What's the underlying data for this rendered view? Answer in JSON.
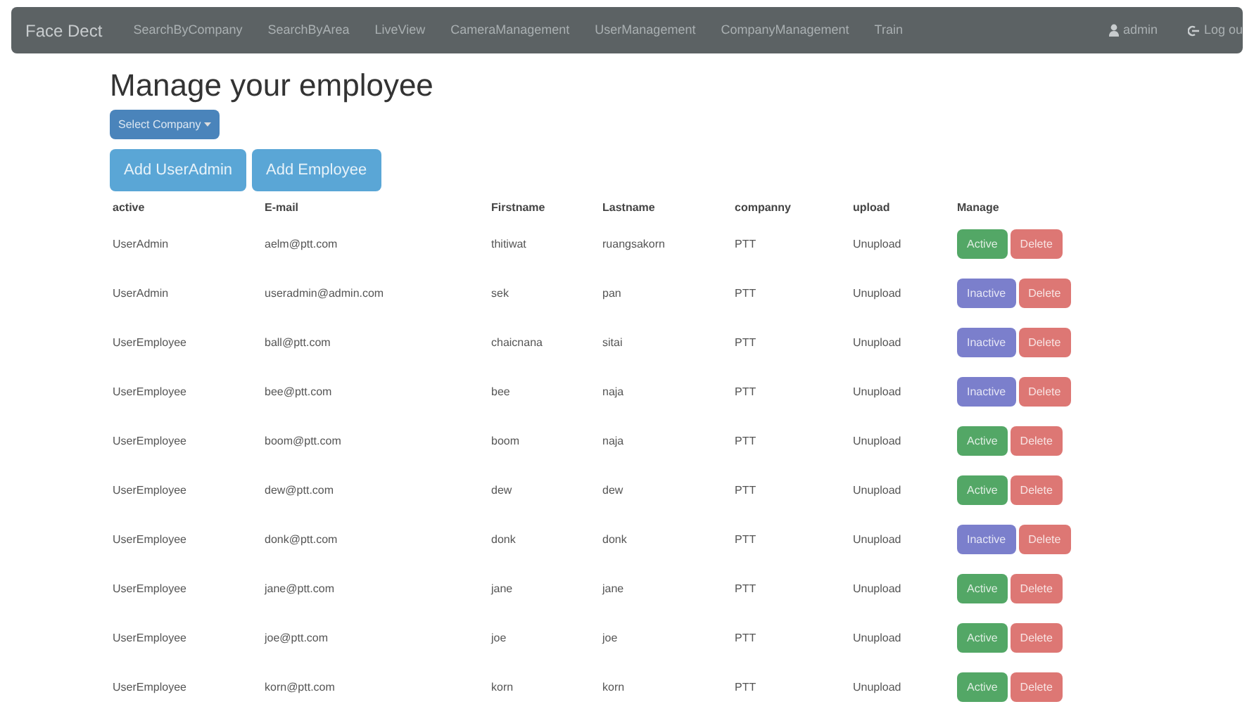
{
  "navbar": {
    "brand": "Face Dect",
    "links": [
      "SearchByCompany",
      "SearchByArea",
      "LiveView",
      "CameraManagement",
      "UserManagement",
      "CompanyManagement",
      "Train"
    ],
    "user": "admin",
    "logout": "Log ou"
  },
  "heading": "Manage your employee",
  "select_company": "Select Company",
  "buttons": [
    "Add UserAdmin",
    "Add Employee"
  ],
  "table": {
    "columns": [
      "active",
      "E-mail",
      "Firstname",
      "Lastname",
      "companny",
      "upload",
      "Manage"
    ],
    "rows": [
      {
        "role": "UserAdmin",
        "email": "aelm@ptt.com",
        "firstname": "thitiwat",
        "lastname": "ruangsakorn",
        "company": "PTT",
        "upload": "Unupload",
        "status": "Active",
        "active": true,
        "delete": "Delete"
      },
      {
        "role": "UserAdmin",
        "email": "useradmin@admin.com",
        "firstname": "sek",
        "lastname": "pan",
        "company": "PTT",
        "upload": "Unupload",
        "status": "Inactive",
        "active": false,
        "delete": "Delete"
      },
      {
        "role": "UserEmployee",
        "email": "ball@ptt.com",
        "firstname": "chaicnana",
        "lastname": "sitai",
        "company": "PTT",
        "upload": "Unupload",
        "status": "Inactive",
        "active": false,
        "delete": "Delete"
      },
      {
        "role": "UserEmployee",
        "email": "bee@ptt.com",
        "firstname": "bee",
        "lastname": "naja",
        "company": "PTT",
        "upload": "Unupload",
        "status": "Inactive",
        "active": false,
        "delete": "Delete"
      },
      {
        "role": "UserEmployee",
        "email": "boom@ptt.com",
        "firstname": "boom",
        "lastname": "naja",
        "company": "PTT",
        "upload": "Unupload",
        "status": "Active",
        "active": true,
        "delete": "Delete"
      },
      {
        "role": "UserEmployee",
        "email": "dew@ptt.com",
        "firstname": "dew",
        "lastname": "dew",
        "company": "PTT",
        "upload": "Unupload",
        "status": "Active",
        "active": true,
        "delete": "Delete"
      },
      {
        "role": "UserEmployee",
        "email": "donk@ptt.com",
        "firstname": "donk",
        "lastname": "donk",
        "company": "PTT",
        "upload": "Unupload",
        "status": "Inactive",
        "active": false,
        "delete": "Delete"
      },
      {
        "role": "UserEmployee",
        "email": "jane@ptt.com",
        "firstname": "jane",
        "lastname": "jane",
        "company": "PTT",
        "upload": "Unupload",
        "status": "Active",
        "active": true,
        "delete": "Delete"
      },
      {
        "role": "UserEmployee",
        "email": "joe@ptt.com",
        "firstname": "joe",
        "lastname": "joe",
        "company": "PTT",
        "upload": "Unupload",
        "status": "Active",
        "active": true,
        "delete": "Delete"
      },
      {
        "role": "UserEmployee",
        "email": "korn@ptt.com",
        "firstname": "korn",
        "lastname": "korn",
        "company": "PTT",
        "upload": "Unupload",
        "status": "Active",
        "active": true,
        "delete": "Delete"
      }
    ]
  }
}
